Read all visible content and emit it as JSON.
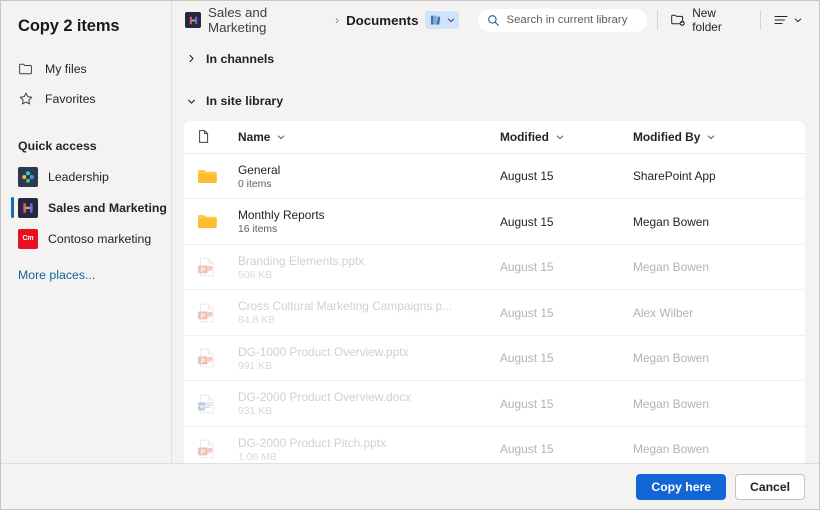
{
  "dialog": {
    "title": "Copy 2 items"
  },
  "sidebar": {
    "nav": [
      {
        "label": "My files",
        "icon": "folder-outline-icon"
      },
      {
        "label": "Favorites",
        "icon": "star-outline-icon"
      }
    ],
    "quick_access_heading": "Quick access",
    "quick_access": [
      {
        "label": "Leadership",
        "icon": "leadership-site-icon",
        "selected": false
      },
      {
        "label": "Sales and Marketing",
        "icon": "sales-site-icon",
        "selected": true
      },
      {
        "label": "Contoso marketing",
        "icon": "contoso-site-icon",
        "badge": "Cm",
        "selected": false
      }
    ],
    "more_places": "More places..."
  },
  "topbar": {
    "breadcrumb_site": "Sales and Marketing",
    "breadcrumb_separator": "›",
    "breadcrumb_current": "Documents",
    "library_chip_icon": "library-books-icon",
    "library_chip_chevron": "chevron-down-icon",
    "search": {
      "placeholder": "Search in current library",
      "value": "",
      "icon": "search-icon"
    },
    "new_folder": {
      "label": "New folder",
      "icon": "new-folder-icon"
    },
    "view_options": {
      "icon": "view-list-icon",
      "chevron": "chevron-down-icon"
    }
  },
  "groups": {
    "in_channels": {
      "label": "In channels",
      "expanded": false,
      "chevron": "chevron-right-icon"
    },
    "in_site_library": {
      "label": "In site library",
      "expanded": true,
      "chevron": "chevron-down-icon"
    }
  },
  "table": {
    "columns": {
      "type_icon": "document-type-icon",
      "name": "Name",
      "modified": "Modified",
      "modified_by": "Modified By",
      "sort_chevron": "chevron-down-icon"
    },
    "rows": [
      {
        "name": "General",
        "sub": "0 items",
        "modified": "August 15",
        "modified_by": "SharePoint App",
        "icon": "folder-icon",
        "disabled": false
      },
      {
        "name": "Monthly Reports",
        "sub": "16 items",
        "modified": "August 15",
        "modified_by": "Megan Bowen",
        "icon": "folder-icon",
        "disabled": false
      },
      {
        "name": "Branding Elements.pptx",
        "sub": "506 KB",
        "modified": "August 15",
        "modified_by": "Megan Bowen",
        "icon": "powerpoint-icon",
        "disabled": true
      },
      {
        "name": "Cross Cultural Marketing Campaigns.p...",
        "sub": "84.8 KB",
        "modified": "August 15",
        "modified_by": "Alex Wilber",
        "icon": "powerpoint-icon",
        "disabled": true
      },
      {
        "name": "DG-1000 Product Overview.pptx",
        "sub": "991 KB",
        "modified": "August 15",
        "modified_by": "Megan Bowen",
        "icon": "powerpoint-icon",
        "disabled": true
      },
      {
        "name": "DG-2000 Product Overview.docx",
        "sub": "931 KB",
        "modified": "August 15",
        "modified_by": "Megan Bowen",
        "icon": "word-icon",
        "disabled": true
      },
      {
        "name": "DG-2000 Product Pitch.pptx",
        "sub": "1.06 MB",
        "modified": "August 15",
        "modified_by": "Megan Bowen",
        "icon": "powerpoint-icon",
        "disabled": true
      }
    ]
  },
  "footer": {
    "primary_label": "Copy here",
    "secondary_label": "Cancel"
  },
  "colors": {
    "accent": "#1366d6",
    "selection_bar": "#0f6cbd",
    "link": "#1264a3",
    "chip_background": "#cfe4fa",
    "folder": "#ffc83d",
    "powerpoint": "#d24726",
    "word": "#2b579a",
    "contoso_red": "#e81123",
    "dialog_background": "#f4f3f2",
    "card_background": "#ffffff"
  }
}
